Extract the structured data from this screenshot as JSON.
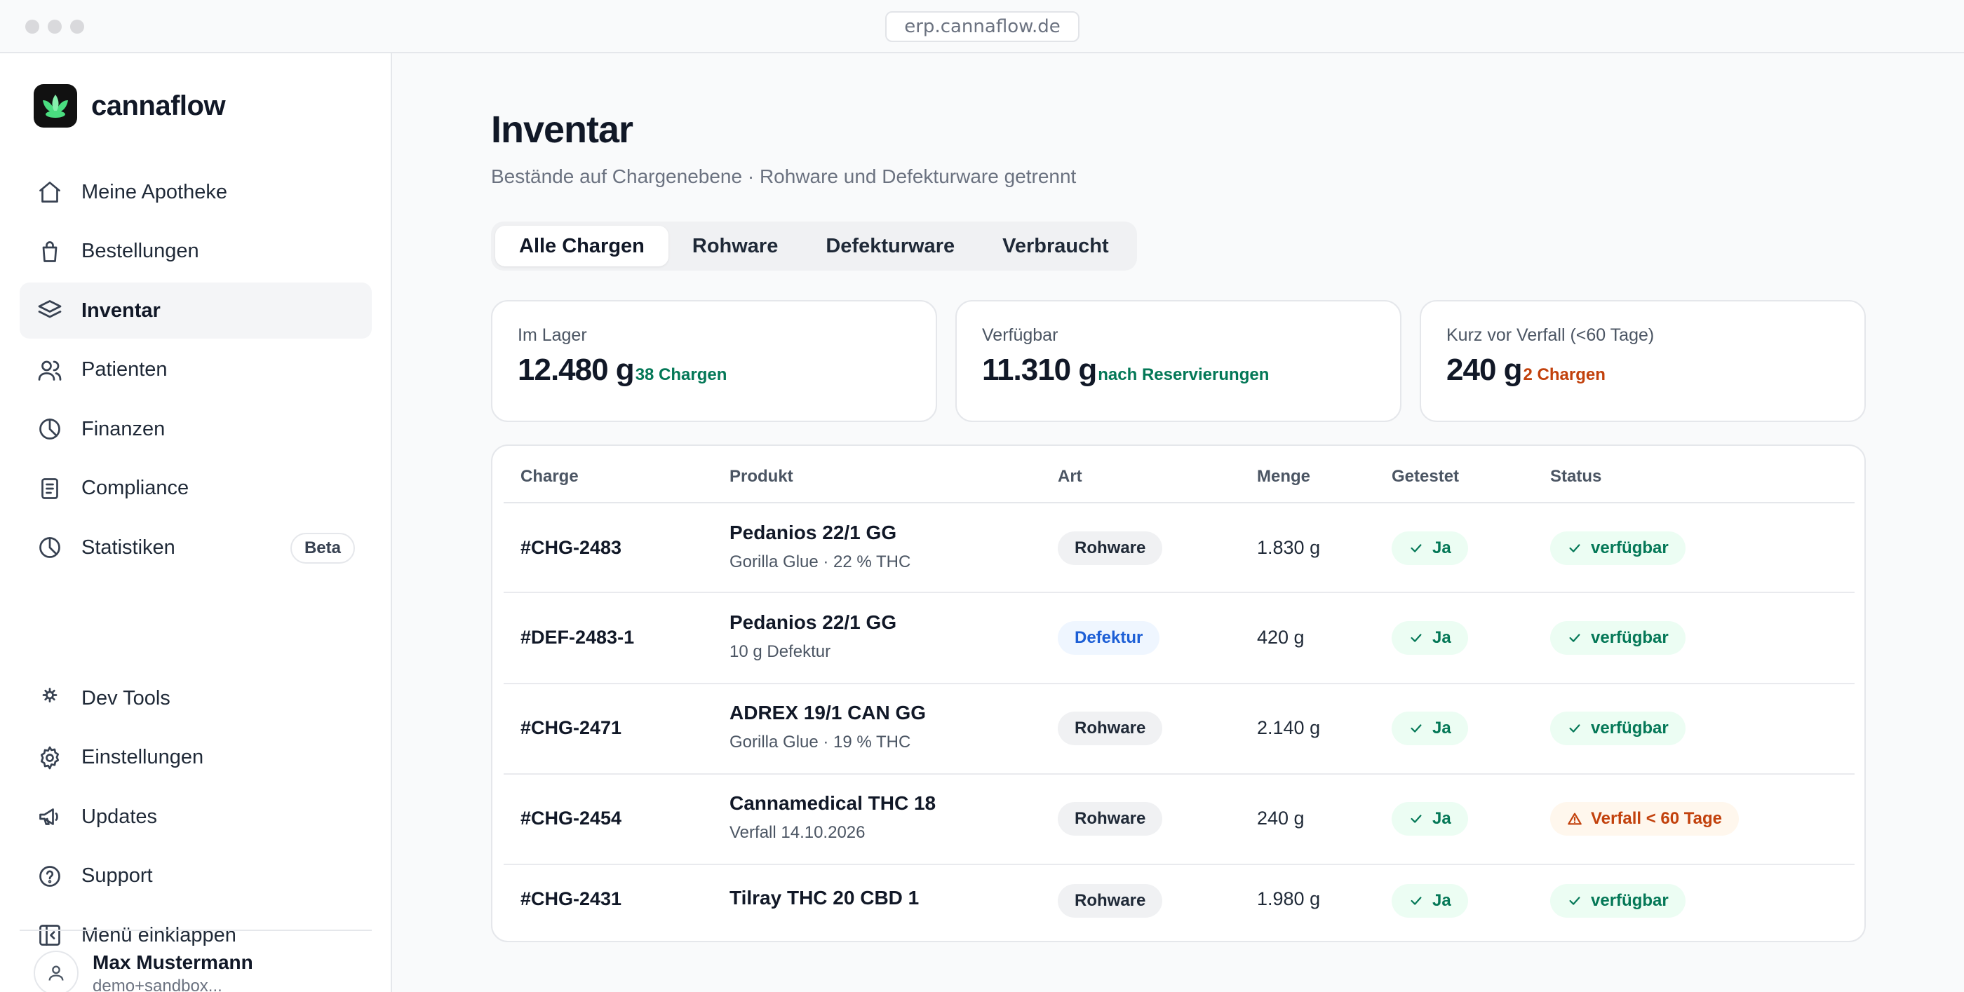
{
  "browser": {
    "url": "erp.cannaflow.de"
  },
  "sidebar": {
    "brand": "cannaflow",
    "items": [
      {
        "label": "Meine Apotheke",
        "icon": "home-icon"
      },
      {
        "label": "Bestellungen",
        "icon": "shopping-bag-icon"
      },
      {
        "label": "Inventar",
        "icon": "layers-icon",
        "active": true
      },
      {
        "label": "Patienten",
        "icon": "users-icon"
      },
      {
        "label": "Finanzen",
        "icon": "pie-chart-icon"
      },
      {
        "label": "Compliance",
        "icon": "document-icon"
      },
      {
        "label": "Statistiken",
        "icon": "pie-chart-icon",
        "badge": "Beta"
      }
    ],
    "secondary": [
      {
        "label": "Dev Tools",
        "icon": "dev-tools-icon"
      },
      {
        "label": "Einstellungen",
        "icon": "gear-icon"
      },
      {
        "label": "Updates",
        "icon": "megaphone-icon"
      },
      {
        "label": "Support",
        "icon": "help-circle-icon"
      },
      {
        "label": "Menü einklappen",
        "icon": "collapse-icon"
      }
    ],
    "user": {
      "name": "Max Mustermann",
      "email": "demo+sandbox..."
    }
  },
  "page": {
    "title": "Inventar",
    "subtitle": "Bestände auf Chargenebene · Rohware und Defekturware getrennt",
    "tabs": [
      "Alle Chargen",
      "Rohware",
      "Defekturware",
      "Verbraucht"
    ],
    "active_tab": "Alle Chargen"
  },
  "stats": [
    {
      "label": "Im Lager",
      "value": "12.480 g",
      "note": "38 Chargen",
      "color": "#047857"
    },
    {
      "label": "Verfügbar",
      "value": "11.310 g",
      "note": "nach Reservierungen",
      "color": "#047857"
    },
    {
      "label": "Kurz vor Verfall (<60 Tage)",
      "value": "240 g",
      "note": "2 Chargen",
      "color": "#c2410c"
    }
  ],
  "table": {
    "columns": [
      "Charge",
      "Produkt",
      "Art",
      "Menge",
      "Getestet",
      "Status"
    ],
    "rows": [
      {
        "charge": "#CHG-2483",
        "product": "Pedanios 22/1 GG",
        "detail": "Gorilla Glue · 22 % THC",
        "art": "Rohware",
        "qty": "1.830 g",
        "tested": "Ja",
        "status": "verfügbar",
        "status_type": "ok"
      },
      {
        "charge": "#DEF-2483-1",
        "product": "Pedanios 22/1 GG",
        "detail": "10 g Defektur",
        "art": "Defektur",
        "qty": "420 g",
        "tested": "Ja",
        "status": "verfügbar",
        "status_type": "ok"
      },
      {
        "charge": "#CHG-2471",
        "product": "ADREX 19/1 CAN GG",
        "detail": "Gorilla Glue · 19 % THC",
        "art": "Rohware",
        "qty": "2.140 g",
        "tested": "Ja",
        "status": "verfügbar",
        "status_type": "ok"
      },
      {
        "charge": "#CHG-2454",
        "product": "Cannamedical THC 18",
        "detail": "Verfall 14.10.2026",
        "art": "Rohware",
        "qty": "240 g",
        "tested": "Ja",
        "status": "Verfall < 60 Tage",
        "status_type": "warn"
      },
      {
        "charge": "#CHG-2431",
        "product": "Tilray THC 20 CBD 1",
        "detail": "",
        "art": "Rohware",
        "qty": "1.980 g",
        "tested": "Ja",
        "status": "verfügbar",
        "status_type": "ok"
      }
    ]
  }
}
